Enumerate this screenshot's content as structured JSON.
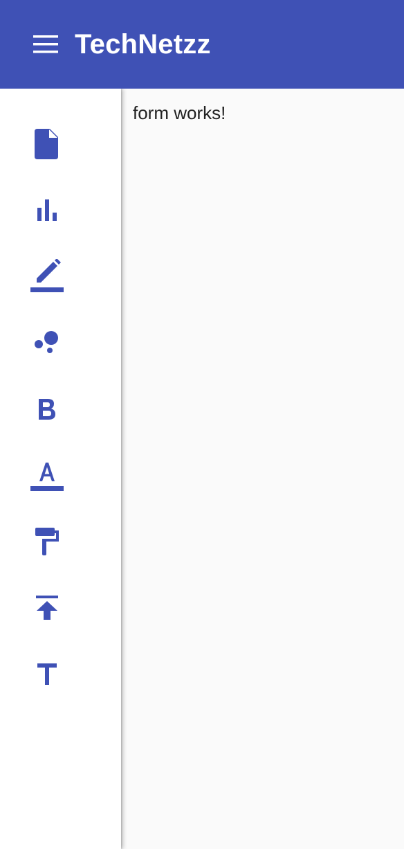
{
  "app": {
    "title": "TechNetzz",
    "menu_icon": "menu-icon"
  },
  "colors": {
    "primary": "#3f51b5",
    "background": "#fafafa",
    "sidenav_background": "#ffffff",
    "text": "#212121"
  },
  "sidenav": {
    "items": [
      {
        "icon": "insert-drive-file-icon"
      },
      {
        "icon": "bar-chart-icon"
      },
      {
        "icon": "border-color-icon"
      },
      {
        "icon": "bubble-chart-icon"
      },
      {
        "icon": "format-bold-icon"
      },
      {
        "icon": "format-color-text-icon"
      },
      {
        "icon": "format-paint-icon"
      },
      {
        "icon": "vertical-align-top-icon"
      },
      {
        "icon": "title-icon"
      }
    ]
  },
  "main": {
    "content_text": "form works!"
  }
}
